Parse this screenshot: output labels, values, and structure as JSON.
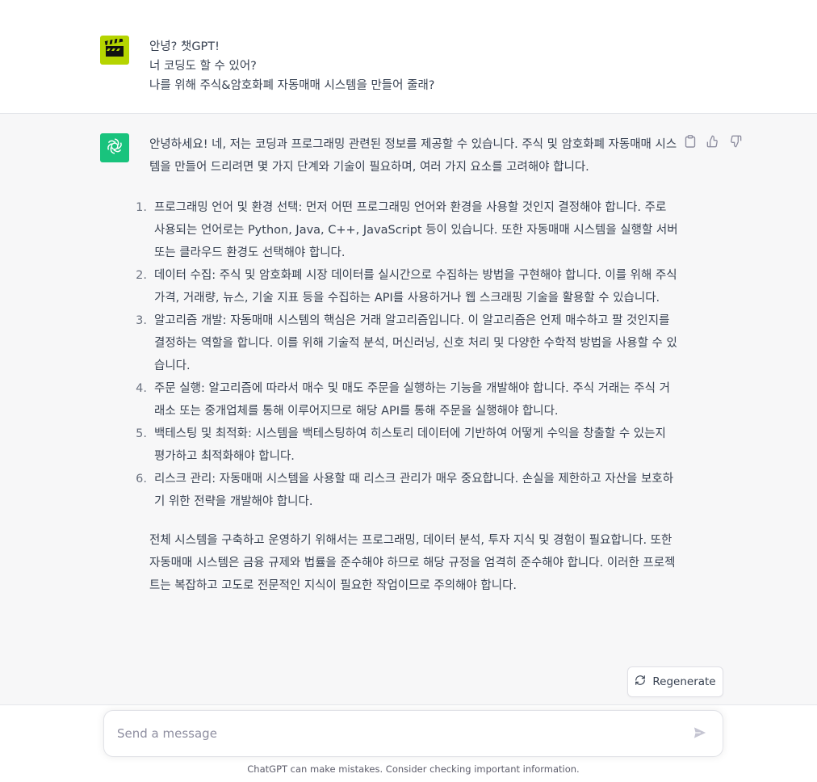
{
  "user_message": {
    "avatar_icon": "clapperboard-icon",
    "lines": [
      "안녕? 챗GPT!",
      "너 코딩도 할 수 있어?",
      "나를 위해 주식&암호화폐 자동매매 시스템을 만들어 줄래?"
    ]
  },
  "assistant_message": {
    "avatar_icon": "openai-logo-icon",
    "intro": "안녕하세요! 네, 저는 코딩과 프로그래밍 관련된 정보를 제공할 수 있습니다. 주식 및 암호화폐 자동매매 시스템을 만들어 드리려면 몇 가지 단계와 기술이 필요하며, 여러 가지 요소를 고려해야 합니다.",
    "steps": [
      {
        "num": "1.",
        "text": "프로그래밍 언어 및 환경 선택: 먼저 어떤 프로그래밍 언어와 환경을 사용할 것인지 결정해야 합니다. 주로 사용되는 언어로는 Python, Java, C++, JavaScript 등이 있습니다. 또한 자동매매 시스템을 실행할 서버 또는 클라우드 환경도 선택해야 합니다."
      },
      {
        "num": "2.",
        "text": "데이터 수집: 주식 및 암호화폐 시장 데이터를 실시간으로 수집하는 방법을 구현해야 합니다. 이를 위해 주식 가격, 거래량, 뉴스, 기술 지표 등을 수집하는 API를 사용하거나 웹 스크래핑 기술을 활용할 수 있습니다."
      },
      {
        "num": "3.",
        "text": "알고리즘 개발: 자동매매 시스템의 핵심은 거래 알고리즘입니다. 이 알고리즘은 언제 매수하고 팔 것인지를 결정하는 역할을 합니다. 이를 위해 기술적 분석, 머신러닝, 신호 처리 및 다양한 수학적 방법을 사용할 수 있습니다."
      },
      {
        "num": "4.",
        "text": "주문 실행: 알고리즘에 따라서 매수 및 매도 주문을 실행하는 기능을 개발해야 합니다. 주식 거래는 주식 거래소 또는 중개업체를 통해 이루어지므로 해당 API를 통해 주문을 실행해야 합니다."
      },
      {
        "num": "5.",
        "text": "백테스팅 및 최적화: 시스템을 백테스팅하여 히스토리 데이터에 기반하여 어떻게 수익을 창출할 수 있는지 평가하고 최적화해야 합니다."
      },
      {
        "num": "6.",
        "text": "리스크 관리: 자동매매 시스템을 사용할 때 리스크 관리가 매우 중요합니다. 손실을 제한하고 자산을 보호하기 위한 전략을 개발해야 합니다."
      }
    ],
    "outro": "전체 시스템을 구축하고 운영하기 위해서는 프로그래밍, 데이터 분석, 투자 지식 및 경험이 필요합니다. 또한 자동매매 시스템은 금융 규제와 법률을 준수해야 하므로 해당 규정을 엄격히 준수해야 합니다. 이러한 프로젝트는 복잡하고 고도로 전문적인 지식이 필요한 작업이므로 주의해야 합니다.",
    "actions": [
      "copy-icon",
      "thumbs-up-icon",
      "thumbs-down-icon"
    ]
  },
  "regenerate": {
    "label": "Regenerate",
    "icon": "refresh-icon"
  },
  "composer": {
    "placeholder": "Send a message",
    "send_icon": "send-icon"
  },
  "footer": {
    "note": "ChatGPT can make mistakes. Consider checking important information."
  },
  "colors": {
    "openai_green": "#19c37d",
    "user_avatar": "#b5d400",
    "assistant_bg": "#f7f7f8"
  }
}
